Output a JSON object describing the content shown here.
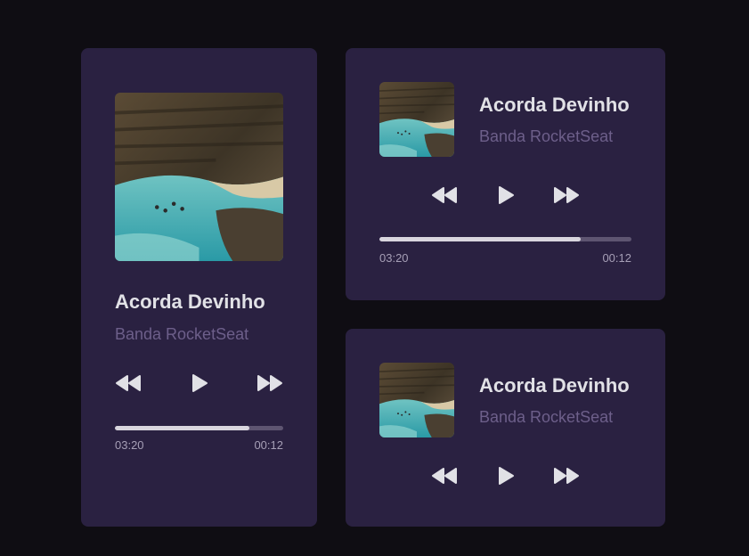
{
  "players": [
    {
      "id": "large",
      "title": "Acorda Devinho",
      "artist": "Banda RocketSeat",
      "elapsed": "03:20",
      "remaining": "00:12",
      "progress": 0.8,
      "controls": [
        "rewind-icon",
        "play-icon",
        "fast-forward-icon"
      ]
    },
    {
      "id": "compact-with-progress",
      "title": "Acorda Devinho",
      "artist": "Banda RocketSeat",
      "elapsed": "03:20",
      "remaining": "00:12",
      "progress": 0.8,
      "controls": [
        "rewind-icon",
        "play-icon",
        "fast-forward-icon"
      ]
    },
    {
      "id": "compact",
      "title": "Acorda Devinho",
      "artist": "Banda RocketSeat",
      "controls": [
        "rewind-icon",
        "play-icon",
        "fast-forward-icon"
      ]
    }
  ],
  "colors": {
    "background": "#0f0d13",
    "card": "#2a2141",
    "title": "#e1e1e6",
    "artist": "#6d5f8a",
    "progress_fill": "#d9d6de",
    "progress_track": "#5e5571",
    "icon": "#e1e1e6"
  }
}
